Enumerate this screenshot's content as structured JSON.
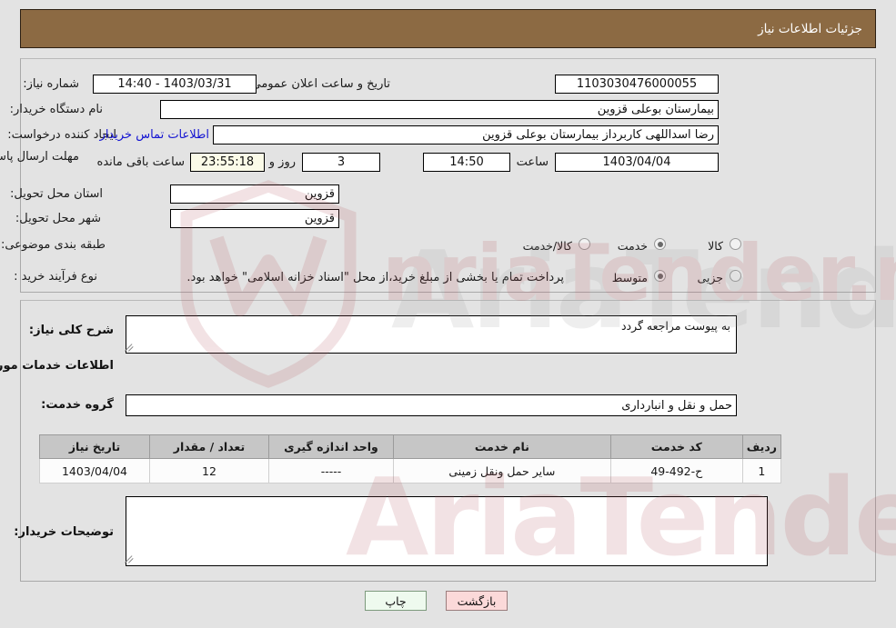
{
  "header": {
    "title": "جزئیات اطلاعات نیاز"
  },
  "form": {
    "need_number_label": "شماره نیاز:",
    "need_number_value": "1103030476000055",
    "announce_datetime_label": "تاریخ و ساعت اعلان عمومی:",
    "announce_datetime_value": "1403/03/31 - 14:40",
    "buyer_org_label": "نام دستگاه خریدار:",
    "buyer_org_value": "بیمارستان بوعلی قزوین",
    "requester_label": "ایجاد کننده درخواست:",
    "requester_value": "رضا اسداللهی کاربرداز بیمارستان بوعلی قزوین",
    "buyer_contact_link": "اطلاعات تماس خریدار",
    "deadline_label": "مهلت ارسال پاسخ: تا تاریخ:",
    "deadline_date_value": "1403/04/04",
    "deadline_hour_label": "ساعت",
    "deadline_hour_value": "14:50",
    "days_value": "3",
    "days_label": "روز و",
    "countdown_value": "23:55:18",
    "countdown_label": "ساعت باقی مانده",
    "province_label": "استان محل تحویل:",
    "province_value": "قزوین",
    "city_label": "شهر محل تحویل:",
    "city_value": "قزوین",
    "category_label": "طبقه بندی موضوعی:",
    "category_options": [
      {
        "label": "کالا",
        "selected": false
      },
      {
        "label": "خدمت",
        "selected": true
      },
      {
        "label": "کالا/خدمت",
        "selected": false
      }
    ],
    "process_label": "نوع فرآیند خرید :",
    "process_options": [
      {
        "label": "جزیی",
        "selected": false
      },
      {
        "label": "متوسط",
        "selected": true
      }
    ],
    "treasury_checkbox_checked": false,
    "treasury_note": "پرداخت تمام یا بخشی از مبلغ خرید،از محل \"اسناد خزانه اسلامی\" خواهد بود."
  },
  "details": {
    "general_desc_label": "شرح کلی نیاز:",
    "general_desc_value": "به پیوست مراجعه گردد",
    "services_section_title": "اطلاعات خدمات مورد نیاز",
    "service_group_label": "گروه خدمت:",
    "service_group_value": "حمل و نقل و انبارداری",
    "buyer_notes_label": "توضیحات خریدار:",
    "buyer_notes_value": ""
  },
  "table": {
    "columns": [
      "ردیف",
      "کد خدمت",
      "نام خدمت",
      "واحد اندازه گیری",
      "تعداد / مقدار",
      "تاریخ نیاز"
    ],
    "rows": [
      {
        "row_no": "1",
        "service_code": "ح-492-49",
        "service_name": "سایر حمل ونقل زمینی",
        "unit": "-----",
        "quantity": "12",
        "need_date": "1403/04/04"
      }
    ]
  },
  "footer": {
    "print_label": "چاپ",
    "back_label": "بازگشت"
  },
  "colors": {
    "titlebar_bg": "#8c6a43",
    "page_bg": "#e3e3e3",
    "link": "#1414d2",
    "countdown_bg": "#fbfbe8",
    "print_bg": "#eefaee",
    "back_bg": "#fbd9d9",
    "table_header_bg": "#c6c6c6"
  },
  "watermark": {
    "text": "AriaTender.net"
  }
}
